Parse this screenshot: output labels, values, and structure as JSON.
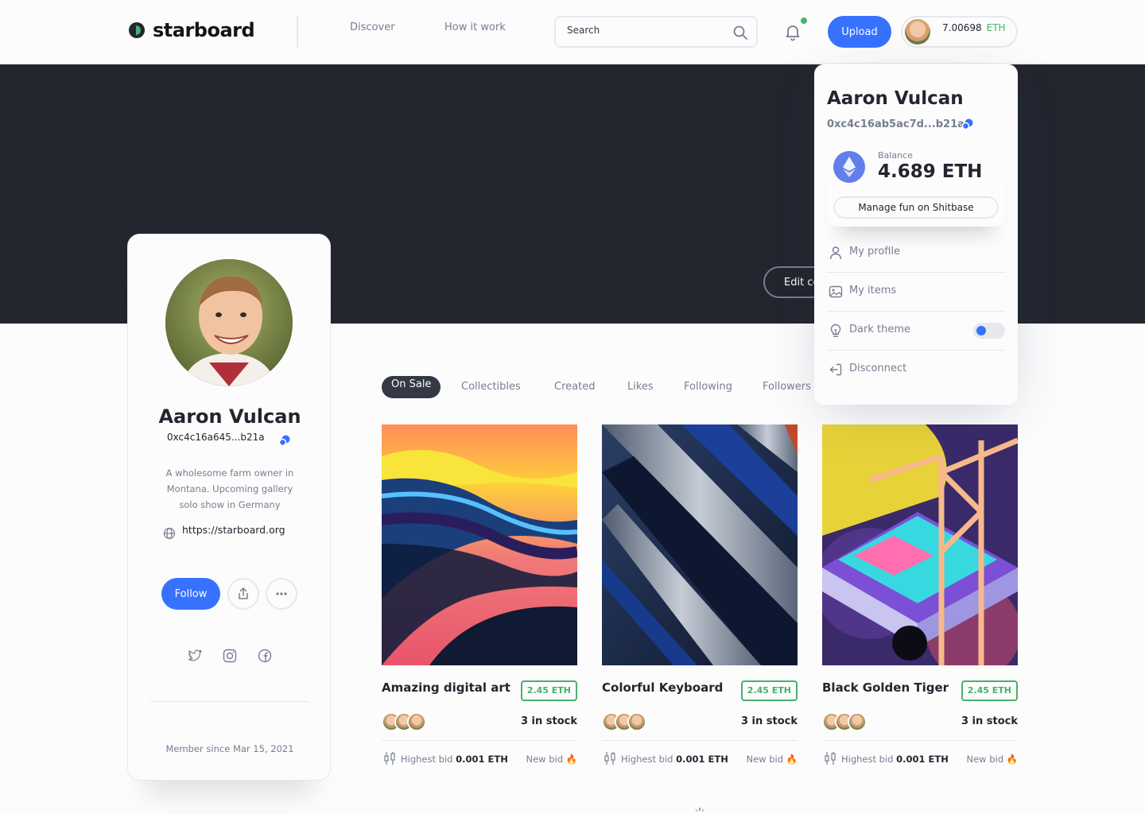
{
  "header": {
    "brand": "starboard",
    "nav": [
      {
        "label": "Discover"
      },
      {
        "label": "How it work"
      }
    ],
    "search_placeholder": "Search",
    "upload_label": "Upload",
    "wallet_amount": "7.00698",
    "wallet_currency": "ETH"
  },
  "cover": {
    "edit_label": "Edit cover photo"
  },
  "profile": {
    "name": "Aaron Vulcan",
    "address": "0xc4c16a645...b21a",
    "bio": "A wholesome farm owner in Montana. Upcoming gallery solo show in Germany",
    "website": "https://starboard.org",
    "follow_label": "Follow",
    "member_since": "Member since Mar 15, 2021"
  },
  "tabs": [
    {
      "label": "On Sale",
      "active": true
    },
    {
      "label": "Collectibles"
    },
    {
      "label": "Created"
    },
    {
      "label": "Likes"
    },
    {
      "label": "Following"
    },
    {
      "label": "Followers"
    }
  ],
  "items": [
    {
      "title": "Amazing digital art",
      "price": "2.45 ETH",
      "stock": "3 in stock",
      "bid_label": "Highest bid",
      "bid_value": "0.001 ETH",
      "new_bid": "New bid"
    },
    {
      "title": "Colorful Keyboard",
      "price": "2.45 ETH",
      "stock": "3 in stock",
      "bid_label": "Highest bid",
      "bid_value": "0.001 ETH",
      "new_bid": "New bid"
    },
    {
      "title": "Black Golden Tiger",
      "price": "2.45 ETH",
      "stock": "3 in stock",
      "bid_label": "Highest bid",
      "bid_value": "0.001 ETH",
      "new_bid": "New bid"
    }
  ],
  "dropdown": {
    "name": "Aaron Vulcan",
    "address": "0xc4c16ab5ac7d...b21a",
    "balance_label": "Balance",
    "balance_value": "4.689 ETH",
    "manage_label": "Manage fun on Shitbase",
    "menu": [
      {
        "label": "My profile",
        "icon": "user-icon"
      },
      {
        "label": "My items",
        "icon": "image-icon"
      },
      {
        "label": "Dark theme",
        "icon": "bulb-icon"
      },
      {
        "label": "Disconnect",
        "icon": "logout-icon"
      }
    ],
    "dark_theme_on": false
  },
  "colors": {
    "accent": "#3772ff",
    "success": "#45b26b",
    "cover": "#23262f"
  }
}
